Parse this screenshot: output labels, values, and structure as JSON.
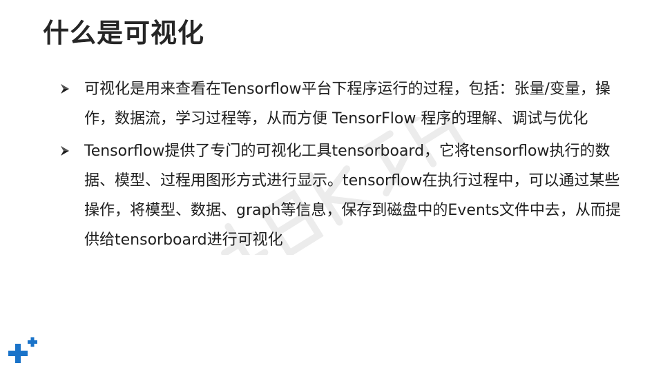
{
  "slide": {
    "title": "什么是可视化",
    "bullets": [
      {
        "text": "可视化是用来查看在Tensorflow平台下程序运行的过程，包括：张量/变量，操作，数据流，学习过程等，从而方便 TensorFlow 程序的理解、调试与优化"
      },
      {
        "text": "Tensorflow提供了专门的可视化工具tensorboard，它将tensorflow执行的数据、模型、过程用图形方式进行显示。tensorflow在执行过程中，可以通过某些操作，将模型、数据、graph等信息，保存到磁盘中的Events文件中去，从而提供给tensorboard进行可视化"
      }
    ],
    "bullet_icon": "arrow-bullet-icon",
    "logo_icon": "plus-logo-icon",
    "colors": {
      "title": "#262626",
      "text": "#1f1f1f",
      "logo": "#1a73c9",
      "watermark": "#e6e6e6"
    }
  }
}
